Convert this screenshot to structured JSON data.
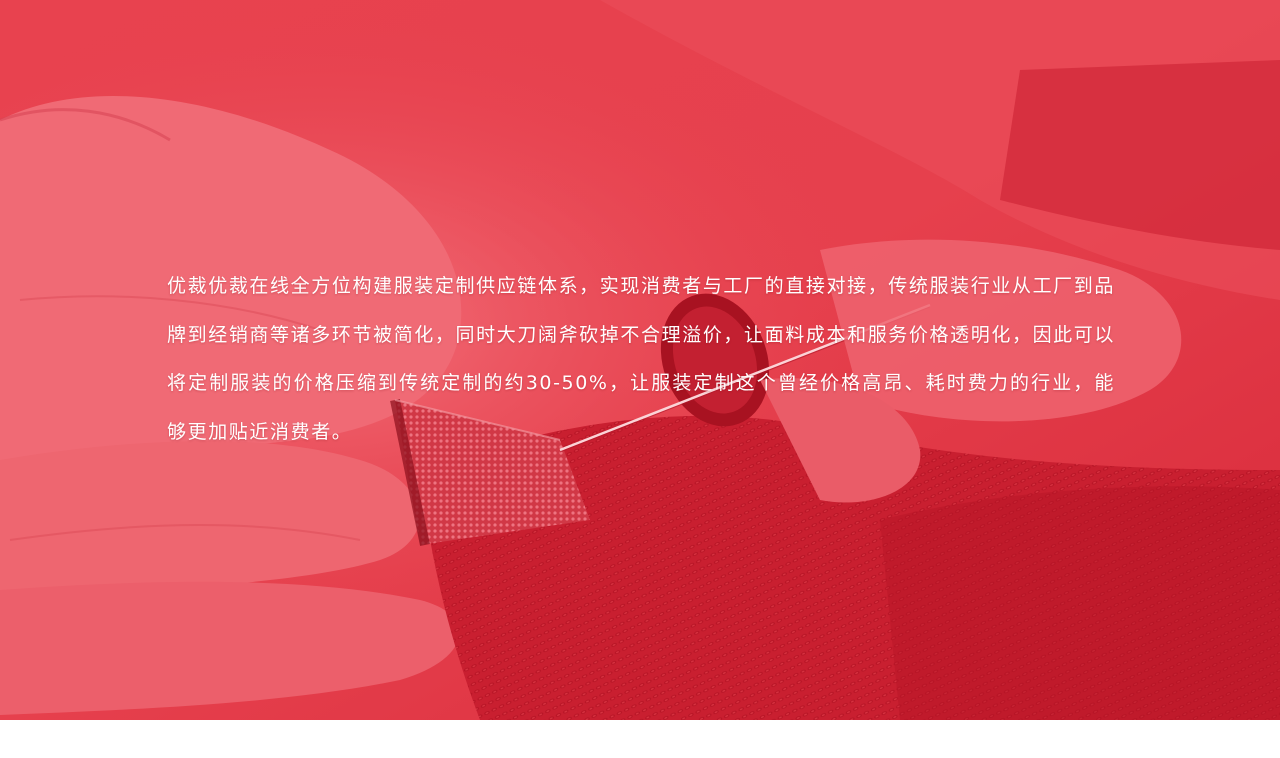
{
  "hero": {
    "image_description_icon": "tailor-sewing-thimble-photo",
    "tint_color": "#e23444",
    "text": "优裁优裁在线全方位构建服装定制供应链体系，实现消费者与工厂的直接对接，传统服装行业从工厂到品牌到经销商等诸多环节被简化，同时大刀阔斧砍掉不合理溢价，让面料成本和服务价格透明化，因此可以将定制服装的价格压缩到传统定制的约30-50%，让服装定制这个曾经价格高昂、耗时费力的行业，能够更加贴近消费者。"
  },
  "colors": {
    "page_background": "#ffffff",
    "text": "#ffffff"
  }
}
